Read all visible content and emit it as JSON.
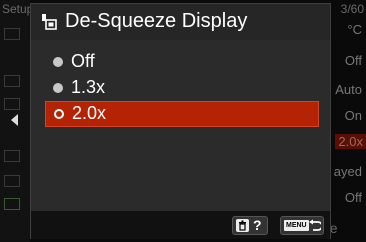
{
  "background": {
    "menu_title": "Setup",
    "page": "3/60",
    "values": [
      "°C",
      "Off",
      "Auto",
      "On",
      "2.0x",
      "ayed",
      "Off"
    ],
    "bottom_text": "ose"
  },
  "dialog": {
    "title": "De-Squeeze Display",
    "title_icon": "movie-display-icon",
    "options": [
      {
        "label": "Off",
        "selected": false
      },
      {
        "label": "1.3x",
        "selected": false
      },
      {
        "label": "2.0x",
        "selected": true
      }
    ],
    "footer": {
      "help_label": "?",
      "help_icon": "trash-key-icon",
      "back_key": "MENU",
      "back_icon": "return-arrow-icon"
    }
  },
  "colors": {
    "selection": "#b32304",
    "dialog_body": "#2b2b2b",
    "header": "#262626"
  }
}
